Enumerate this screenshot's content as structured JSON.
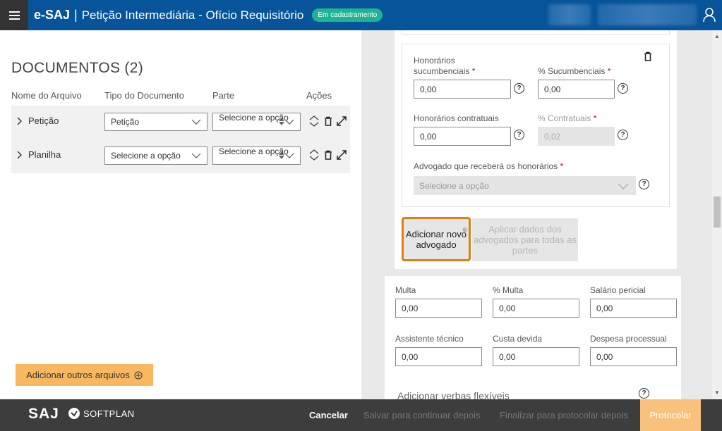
{
  "header": {
    "brand": "e-SAJ",
    "separator": "|",
    "title": "Petição Intermediária - Ofício Requisitório",
    "status": "Em cadastramento"
  },
  "documents": {
    "title": "DOCUMENTOS (2)",
    "columns": [
      "Nome do Arquivo",
      "Tipo do Documento",
      "Parte",
      "Ações"
    ],
    "rows": [
      {
        "name": "Petição",
        "type": "Petição",
        "part": "Selecione a opção"
      },
      {
        "name": "Planilha",
        "type": "Selecione a opção",
        "part": "Selecione a opção"
      }
    ],
    "add_files_label": "Adicionar outros arquivos"
  },
  "fees": {
    "hon_suc_label_1": "Honorários",
    "hon_suc_label_2": "sucumbenciais",
    "hon_suc_value": "0,00",
    "pct_suc_label": "% Sucumbenciais",
    "pct_suc_value": "0,00",
    "hon_con_label": "Honorários contratuais",
    "hon_con_value": "0,00",
    "pct_con_label": "% Contratuais",
    "pct_con_value": "0,02",
    "lawyer_label": "Advogado que receberá os honorários",
    "lawyer_placeholder": "Selecione a opção",
    "required_mark": "*",
    "help_mark": "?"
  },
  "buttons": {
    "add_lawyer": "Adicionar novo advogado",
    "apply_all": "Aplicar dados dos advogados para todas as partes"
  },
  "values": {
    "multa_label": "Multa",
    "multa": "0,00",
    "pct_multa_label": "% Multa",
    "pct_multa": "0,00",
    "salario_label": "Salário pericial",
    "salario": "0,00",
    "assist_label": "Assistente técnico",
    "assist": "0,00",
    "custa_label": "Custa devida",
    "custa": "0,00",
    "despesa_label": "Despesa processual",
    "despesa": "0,00",
    "flex_title": "Adicionar verbas flexíveis"
  },
  "footer": {
    "logo_saj": "SAJ",
    "logo_softplan": "SOFTPLAN",
    "cancel": "Cancelar",
    "save_later": "Salvar para continuar depois",
    "finalize_later": "Finalizar para protocolar depois",
    "protocol": "Protocolar"
  },
  "colors": {
    "header_blue": "#07549b",
    "badge_green": "#1fb393",
    "accent_orange": "#e07e12",
    "button_orange": "#f9b860",
    "footer_dark": "#3d3d3d"
  },
  "icons": [
    "menu-icon",
    "user-icon",
    "chevron-right-icon",
    "chevron-down-icon",
    "sort-icon",
    "trash-icon",
    "expand-icon",
    "plus-circle-icon",
    "help-icon",
    "shield-logo-icon"
  ]
}
